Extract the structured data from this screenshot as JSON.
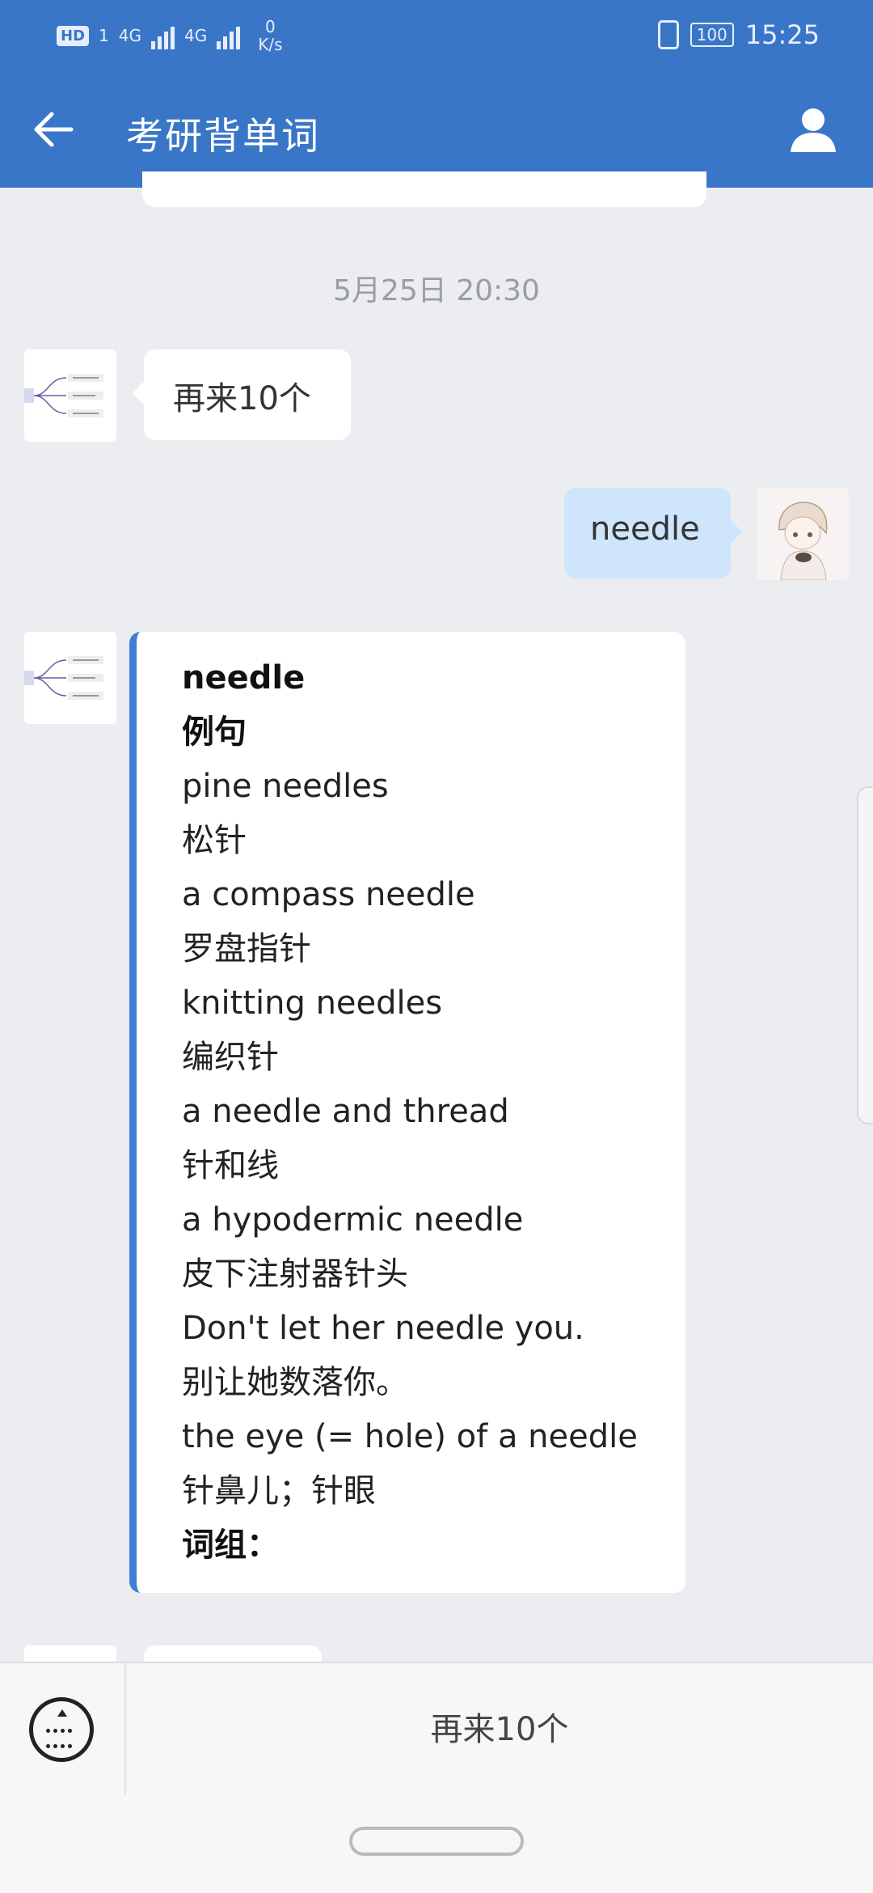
{
  "status_bar": {
    "hd_label": "HD",
    "sim1_label": "1",
    "net_type_1": "4G",
    "net_type_2": "4G",
    "speed_value": "0",
    "speed_unit": "K/s",
    "battery": "100",
    "time": "15:25"
  },
  "header": {
    "title": "考研背单词",
    "back_icon": "arrow-left-icon",
    "profile_icon": "user-icon",
    "background_color": "#3a76c8"
  },
  "chat": {
    "timestamp": "5月25日  20:30",
    "messages": [
      {
        "side": "left",
        "text": "再来10个"
      },
      {
        "side": "right",
        "text": "needle"
      }
    ],
    "card": {
      "accent_color": "#3e7fd6",
      "lines": [
        {
          "text": "needle",
          "bold": true
        },
        {
          "text": "例句",
          "bold": true
        },
        {
          "text": "pine needles",
          "bold": false
        },
        {
          "text": "松针",
          "bold": false
        },
        {
          "text": "a compass needle",
          "bold": false
        },
        {
          "text": "罗盘指针",
          "bold": false
        },
        {
          "text": "knitting needles",
          "bold": false
        },
        {
          "text": "编织针",
          "bold": false
        },
        {
          "text": "a needle and thread",
          "bold": false
        },
        {
          "text": "针和线",
          "bold": false
        },
        {
          "text": "a hypodermic needle",
          "bold": false
        },
        {
          "text": "皮下注射器针头",
          "bold": false
        },
        {
          "text": "Don't let her needle you.",
          "bold": false
        },
        {
          "text": "别让她数落你。",
          "bold": false
        },
        {
          "text": "the eye (= hole) of a needle",
          "bold": false
        },
        {
          "text": "针鼻儿；针眼",
          "bold": false
        },
        {
          "text": "词组：",
          "bold": true
        }
      ]
    }
  },
  "bottom_menu": {
    "keyboard_icon": "keyboard-toggle-icon",
    "item_label": "再来10个"
  },
  "colors": {
    "user_bubble": "#cfe5fb",
    "page_background": "#ebedf0"
  }
}
